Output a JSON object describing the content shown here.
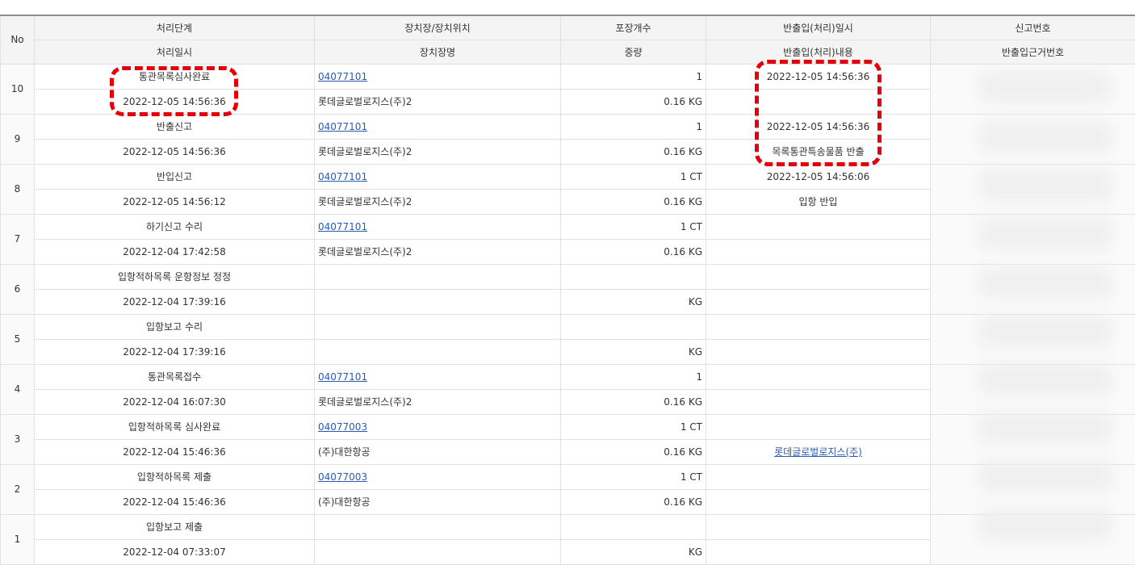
{
  "header": {
    "no": "No",
    "row1": [
      "처리단계",
      "장치장/장치위치",
      "포장개수",
      "반출입(처리)일시",
      "신고번호"
    ],
    "row2": [
      "처리일시",
      "장치장명",
      "중량",
      "반출입(처리)내용",
      "반출입근거번호"
    ]
  },
  "rows": [
    {
      "no": "10",
      "stage": "통관목록심사완료",
      "datetime": "2022-12-05 14:56:36",
      "location": "04077101",
      "location_name": "롯데글로벌로지스(주)2",
      "packages": "1",
      "weight": "0.16 KG",
      "inout_datetime": "2022-12-05 14:56:36",
      "inout_content": "",
      "inout_link": false
    },
    {
      "no": "9",
      "stage": "반출신고",
      "datetime": "2022-12-05 14:56:36",
      "location": "04077101",
      "location_name": "롯데글로벌로지스(주)2",
      "packages": "1",
      "weight": "0.16 KG",
      "inout_datetime": "2022-12-05 14:56:36",
      "inout_content": "목록통관특송물품 반출",
      "inout_link": false
    },
    {
      "no": "8",
      "stage": "반입신고",
      "datetime": "2022-12-05 14:56:12",
      "location": "04077101",
      "location_name": "롯데글로벌로지스(주)2",
      "packages": "1 CT",
      "weight": "0.16 KG",
      "inout_datetime": "2022-12-05 14:56:06",
      "inout_content": "입항 반입",
      "inout_link": false
    },
    {
      "no": "7",
      "stage": "하기신고 수리",
      "datetime": "2022-12-04 17:42:58",
      "location": "04077101",
      "location_name": "롯데글로벌로지스(주)2",
      "packages": "1 CT",
      "weight": "0.16 KG",
      "inout_datetime": "",
      "inout_content": "",
      "inout_link": false
    },
    {
      "no": "6",
      "stage": "입항적하목록 운항정보 정정",
      "datetime": "2022-12-04 17:39:16",
      "location": "",
      "location_name": "",
      "packages": "",
      "weight": "KG",
      "inout_datetime": "",
      "inout_content": "",
      "inout_link": false
    },
    {
      "no": "5",
      "stage": "입항보고 수리",
      "datetime": "2022-12-04 17:39:16",
      "location": "",
      "location_name": "",
      "packages": "",
      "weight": "KG",
      "inout_datetime": "",
      "inout_content": "",
      "inout_link": false
    },
    {
      "no": "4",
      "stage": "통관목록접수",
      "datetime": "2022-12-04 16:07:30",
      "location": "04077101",
      "location_name": "롯데글로벌로지스(주)2",
      "packages": "1",
      "weight": "0.16 KG",
      "inout_datetime": "",
      "inout_content": "",
      "inout_link": false
    },
    {
      "no": "3",
      "stage": "입항적하목록 심사완료",
      "datetime": "2022-12-04 15:46:36",
      "location": "04077003",
      "location_name": "(주)대한항공",
      "packages": "1 CT",
      "weight": "0.16 KG",
      "inout_datetime": "",
      "inout_content": "롯데글로벌로지스(주)",
      "inout_link": true
    },
    {
      "no": "2",
      "stage": "입항적하목록 제출",
      "datetime": "2022-12-04 15:46:36",
      "location": "04077003",
      "location_name": "(주)대한항공",
      "packages": "1 CT",
      "weight": "0.16 KG",
      "inout_datetime": "",
      "inout_content": "",
      "inout_link": false
    },
    {
      "no": "1",
      "stage": "입항보고 제출",
      "datetime": "2022-12-04 07:33:07",
      "location": "",
      "location_name": "",
      "packages": "",
      "weight": "KG",
      "inout_datetime": "",
      "inout_content": "",
      "inout_link": false
    }
  ],
  "colors": {
    "link": "#2a5cb3",
    "annotation": "#e3000b",
    "header_bg": "#f4f4f4",
    "border": "#e1e1e1"
  }
}
